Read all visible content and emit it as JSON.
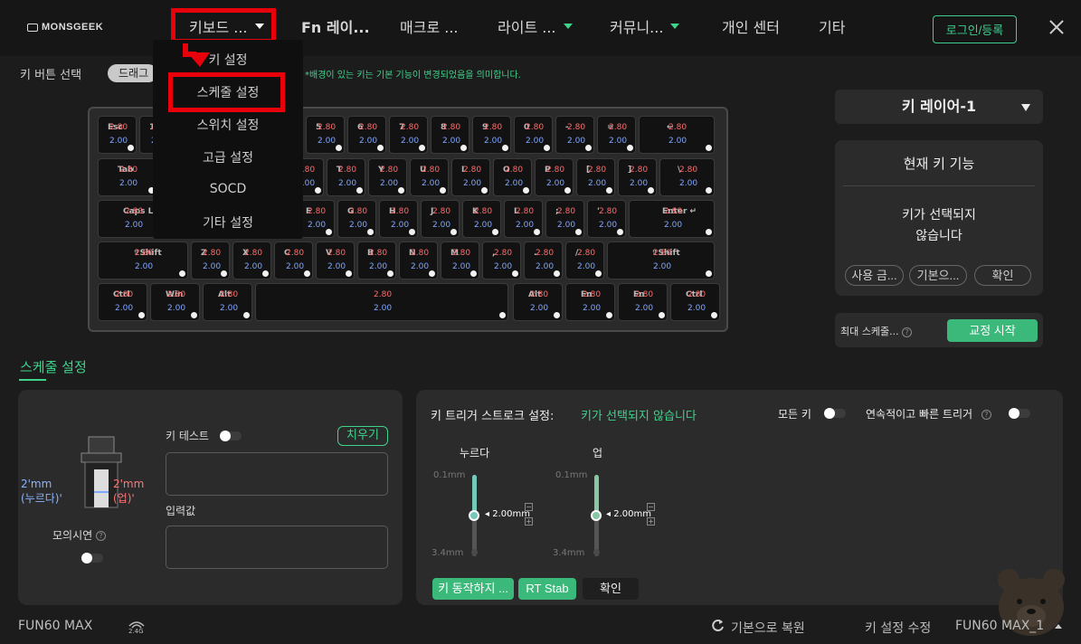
{
  "brand": "MONSGEEK",
  "nav": {
    "items": [
      {
        "label": "키보드 ...",
        "caret": true
      },
      {
        "label": "Fn 레이...",
        "caret": false
      },
      {
        "label": "매크로 ...",
        "caret": false
      },
      {
        "label": "라이트 ...",
        "caret": true
      },
      {
        "label": "커뮤니...",
        "caret": true
      },
      {
        "label": "개인 센터",
        "caret": false
      },
      {
        "label": "기타",
        "caret": false
      }
    ],
    "login": "로그인/등록"
  },
  "dropdown": [
    "키 설정",
    "스케줄 설정",
    "스위치 설정",
    "고급 설정",
    "SOCD",
    "기타 설정"
  ],
  "key_select": {
    "label": "키 버튼 선택",
    "drag": "드래그",
    "note": "*배경이 있는 키는 기본 기능이 변경되었음을 의미합니다."
  },
  "keyboard": {
    "rows": [
      [
        {
          "l": "Esc",
          "v": "2.80",
          "w": "2.00"
        },
        {
          "l": "1",
          "v": "2.80",
          "w": "2.00"
        },
        {
          "l": "2",
          "v": "2.80",
          "w": "2.00"
        },
        {
          "l": "3",
          "v": "2.80",
          "w": "2.00"
        },
        {
          "l": "4",
          "v": "2.80",
          "w": "2.00"
        },
        {
          "l": "5",
          "v": "2.80",
          "w": "2.00"
        },
        {
          "l": "6",
          "v": "2.80",
          "w": "2.00"
        },
        {
          "l": "7",
          "v": "2.80",
          "w": "2.00"
        },
        {
          "l": "8",
          "v": "2.80",
          "w": "2.00"
        },
        {
          "l": "9",
          "v": "2.80",
          "w": "2.00"
        },
        {
          "l": "0",
          "v": "2.80",
          "w": "2.00"
        },
        {
          "l": "-",
          "v": "2.80",
          "w": "2.00"
        },
        {
          "l": "=",
          "v": "2.80",
          "w": "2.00"
        },
        {
          "l": "←",
          "v": "2.80",
          "w": "2.00"
        }
      ],
      [
        {
          "l": "Tab",
          "v": "2.80",
          "w": "2.00"
        },
        {
          "l": "Q",
          "v": "2.80",
          "w": "2.00"
        },
        {
          "l": "W",
          "v": "2.80",
          "w": "2.00"
        },
        {
          "l": "E",
          "v": "2.80",
          "w": "2.00"
        },
        {
          "l": "R",
          "v": "2.80",
          "w": "2.00"
        },
        {
          "l": "T",
          "v": "2.80",
          "w": "2.00"
        },
        {
          "l": "Y",
          "v": "2.80",
          "w": "2.00"
        },
        {
          "l": "U",
          "v": "2.80",
          "w": "2.00"
        },
        {
          "l": "I",
          "v": "2.80",
          "w": "2.00"
        },
        {
          "l": "O",
          "v": "2.80",
          "w": "2.00"
        },
        {
          "l": "P",
          "v": "2.80",
          "w": "2.00"
        },
        {
          "l": "[",
          "v": "2.80",
          "w": "2.00"
        },
        {
          "l": "]",
          "v": "2.80",
          "w": "2.00"
        },
        {
          "l": "\\",
          "v": "2.80",
          "w": "2.00"
        }
      ],
      [
        {
          "l": "Caps Lk",
          "v": "2.80",
          "w": "2.00"
        },
        {
          "l": "A",
          "v": "2.80",
          "w": "2.00"
        },
        {
          "l": "S",
          "v": "2.80",
          "w": "2.00"
        },
        {
          "l": "D",
          "v": "2.80",
          "w": "2.00"
        },
        {
          "l": "F",
          "v": "2.80",
          "w": "2.00"
        },
        {
          "l": "G",
          "v": "2.80",
          "w": "2.00"
        },
        {
          "l": "H",
          "v": "2.80",
          "w": "2.00"
        },
        {
          "l": "J",
          "v": "2.80",
          "w": "2.00"
        },
        {
          "l": "K",
          "v": "2.80",
          "w": "2.00"
        },
        {
          "l": "L",
          "v": "2.80",
          "w": "2.00"
        },
        {
          "l": ";",
          "v": "2.80",
          "w": "2.00"
        },
        {
          "l": "'",
          "v": "2.80",
          "w": "2.00"
        },
        {
          "l": "Enter ↵",
          "v": "2.80",
          "w": "2.00"
        }
      ],
      [
        {
          "l": "⇧Shift",
          "v": "2.80",
          "w": "2.00"
        },
        {
          "l": "Z",
          "v": "2.80",
          "w": "2.00"
        },
        {
          "l": "X",
          "v": "2.80",
          "w": "2.00"
        },
        {
          "l": "C",
          "v": "2.80",
          "w": "2.00"
        },
        {
          "l": "V",
          "v": "2.80",
          "w": "2.00"
        },
        {
          "l": "B",
          "v": "2.80",
          "w": "2.00"
        },
        {
          "l": "N",
          "v": "2.80",
          "w": "2.00"
        },
        {
          "l": "M",
          "v": "2.80",
          "w": "2.00"
        },
        {
          "l": ",",
          "v": "2.80",
          "w": "2.00"
        },
        {
          "l": ".",
          "v": "2.80",
          "w": "2.00"
        },
        {
          "l": "/",
          "v": "2.80",
          "w": "2.00"
        },
        {
          "l": "⇧Shift",
          "v": "2.80",
          "w": "2.00"
        }
      ],
      [
        {
          "l": "Ctrl",
          "v": "2.80",
          "w": "2.00"
        },
        {
          "l": "Win",
          "v": "2.80",
          "w": "2.00"
        },
        {
          "l": "Alt",
          "v": "2.80",
          "w": "2.00"
        },
        {
          "l": "",
          "v": "2.80",
          "w": "2.00"
        },
        {
          "l": "Alt",
          "v": "2.80",
          "w": "2.00"
        },
        {
          "l": "Fn",
          "v": "2.80",
          "w": "2.00"
        },
        {
          "l": "Fn",
          "v": "2.80",
          "w": "2.00"
        },
        {
          "l": "Ctrl",
          "v": "2.80",
          "w": "2.00"
        }
      ]
    ]
  },
  "right": {
    "layer": "키 레이어-1",
    "func_title": "현재 키 기능",
    "func_msg1": "키가 선택되지",
    "func_msg2": "않습니다",
    "btn_use": "사용 금...",
    "btn_default": "기본으...",
    "btn_confirm": "확인",
    "calib_label": "최대 스케줄...",
    "calib_btn": "교정 시작"
  },
  "section": {
    "title": "스케줄 설정"
  },
  "left_panel": {
    "label_press": "2'mm",
    "label_press_sub": "(누르다)'",
    "label_up": "2'mm",
    "label_up_sub": "(업)'",
    "sim_label": "모의시연",
    "key_test": "키 테스트",
    "clear": "치우기",
    "input_label": "입력값"
  },
  "trigger": {
    "title": "키 트리거 스트로크 설정:",
    "status": "키가 선택되지 않습니다",
    "all_keys": "모든 키",
    "rapid": "연속적이고 빠른 트리거",
    "press_label": "누르다",
    "up_label": "업",
    "min": "0.1mm",
    "max": "3.4mm",
    "press_value": "2.00mm",
    "up_value": "2.00mm",
    "press_level": 0.5,
    "up_level": 0.5,
    "btn_noact": "키 동작하지 ...",
    "btn_rt": "RT Stab",
    "btn_ok": "확인"
  },
  "bottom": {
    "device": "FUN60 MAX",
    "wireless": "2.4G",
    "restore": "기본으로 복원",
    "modify": "키 설정 수정",
    "profile": "FUN60 MAX_1"
  },
  "colors": {
    "accent": "#3fd38c",
    "highlight": "#e8000a",
    "panel": "#2b2b2b"
  }
}
